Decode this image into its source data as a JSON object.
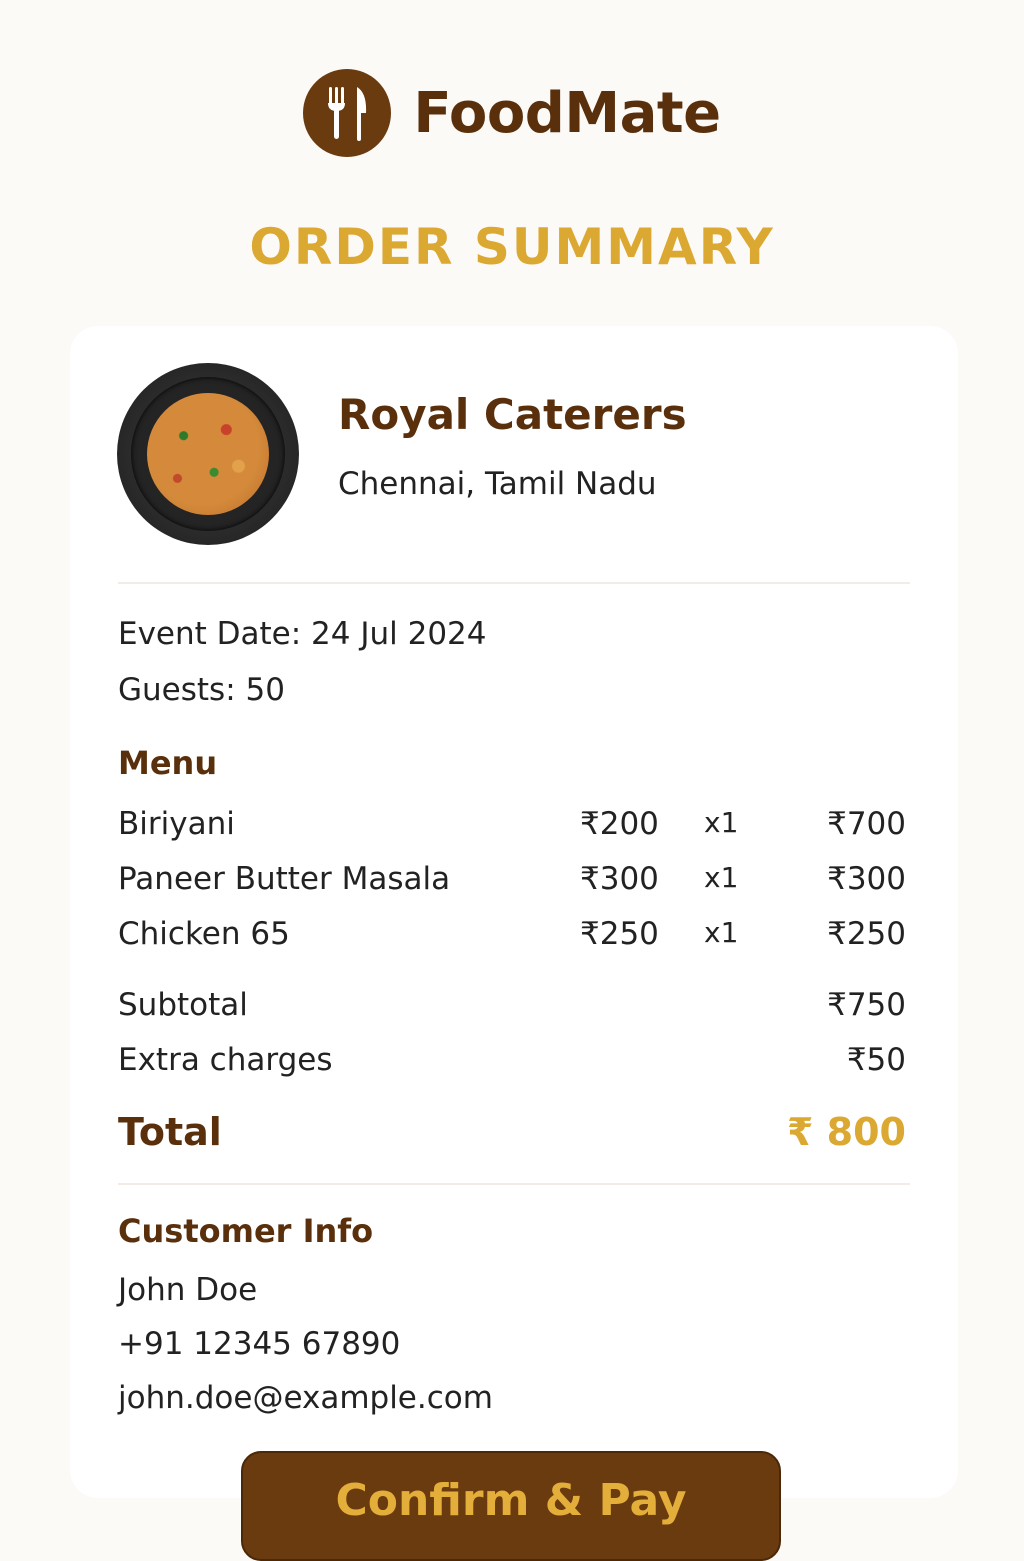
{
  "brand": {
    "name": "FoodMate",
    "logo_icon": "fork-knife-icon"
  },
  "page_title": "ORDER SUMMARY",
  "vendor": {
    "name": "Royal Caterers",
    "location": "Chennai, Tamil Nadu",
    "image_icon": "food-plate-image"
  },
  "event": {
    "date_text": "Event Date: 24 Jul 2024",
    "guests_text": "Guests: 50"
  },
  "menu": {
    "title": "Menu",
    "items": [
      {
        "name": "Biriyani",
        "price": "₹200",
        "qty": "x1",
        "amount": "₹700"
      },
      {
        "name": "Paneer Butter Masala",
        "price": "₹300",
        "qty": "x1",
        "amount": "₹300"
      },
      {
        "name": "Chicken 65",
        "price": "₹250",
        "qty": "x1",
        "amount": "₹250"
      }
    ]
  },
  "summary": {
    "subtotal_label": "Subtotal",
    "subtotal_value": "₹750",
    "extra_label": "Extra charges",
    "extra_value": "₹50",
    "total_label": "Total",
    "total_value": "₹ 800"
  },
  "customer": {
    "title": "Customer Info",
    "name": "John Doe",
    "phone": "+91 12345 67890",
    "email": "john.doe@example.com"
  },
  "actions": {
    "confirm_label": "Confirm & Pay"
  },
  "colors": {
    "brand_brown": "#6b3b10",
    "heading_brown": "#5a300c",
    "accent_gold": "#dba832",
    "background": "#fcfaf7",
    "card": "#ffffff"
  }
}
